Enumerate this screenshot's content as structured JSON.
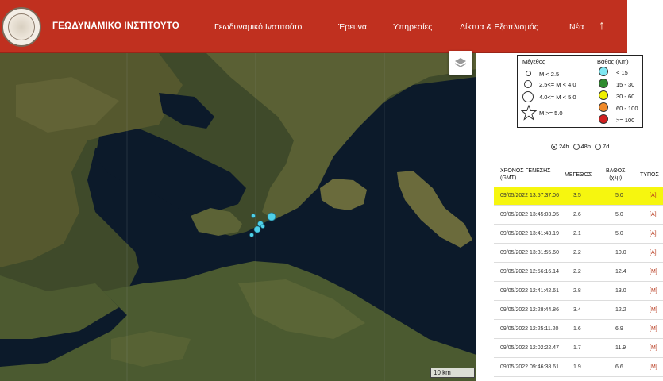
{
  "header": {
    "brand": "ΓΕΩΔΥΝΑΜΙΚΟ ΙΝΣΤΙΤΟΥΤΟ",
    "nav": [
      "Γεωδυναμικό Ινστιτούτο",
      "Έρευνα",
      "Υπηρεσίες",
      "Δίκτυα & Εξοπλισμός",
      "Νέα"
    ],
    "up_arrow": "↑"
  },
  "map": {
    "scale_label": "10 km",
    "layers_icon": "layers-icon",
    "event_color": "#4fd0e8"
  },
  "legend": {
    "magnitude_title": "Μέγεθος",
    "magnitude_items": [
      "M < 2.5",
      "2.5<= M < 4.0",
      "4.0<= M < 5.0",
      "M >= 5.0"
    ],
    "depth_title": "Βάθος (Km)",
    "depth_items": [
      {
        "label": "< 15",
        "color": "#7fe7f2"
      },
      {
        "label": "15 - 30",
        "color": "#2e8b2e"
      },
      {
        "label": "30 - 60",
        "color": "#f0f000"
      },
      {
        "label": "60 - 100",
        "color": "#f08a2a"
      },
      {
        "label": ">= 100",
        "color": "#d12020"
      }
    ]
  },
  "periods": {
    "options": [
      "24h",
      "48h",
      "7d"
    ],
    "selected": "24h"
  },
  "table": {
    "headers": {
      "time": "ΧΡΟΝΟΣ ΓΕΝΕΣΗΣ\n(GMT)",
      "magnitude": "ΜΕΓΕΘΟΣ",
      "depth": "ΒΑΘΟΣ\n(χλμ)",
      "type": "ΤΥΠΟΣ"
    },
    "rows": [
      {
        "time": "09/05/2022 13:57:37.06",
        "mag": "3.5",
        "depth": "5.0",
        "type": "[A]"
      },
      {
        "time": "09/05/2022 13:45:03.95",
        "mag": "2.6",
        "depth": "5.0",
        "type": "[A]"
      },
      {
        "time": "09/05/2022 13:41:43.19",
        "mag": "2.1",
        "depth": "5.0",
        "type": "[A]"
      },
      {
        "time": "09/05/2022 13:31:55.60",
        "mag": "2.2",
        "depth": "10.0",
        "type": "[A]"
      },
      {
        "time": "09/05/2022 12:56:16.14",
        "mag": "2.2",
        "depth": "12.4",
        "type": "[M]"
      },
      {
        "time": "09/05/2022 12:41:42.61",
        "mag": "2.8",
        "depth": "13.0",
        "type": "[M]"
      },
      {
        "time": "09/05/2022 12:28:44.86",
        "mag": "3.4",
        "depth": "12.2",
        "type": "[M]"
      },
      {
        "time": "09/05/2022 12:25:11.20",
        "mag": "1.6",
        "depth": "6.9",
        "type": "[M]"
      },
      {
        "time": "09/05/2022 12:02:22.47",
        "mag": "1.7",
        "depth": "11.9",
        "type": "[M]"
      },
      {
        "time": "09/05/2022 09:46:38.61",
        "mag": "1.9",
        "depth": "6.6",
        "type": "[M]"
      }
    ]
  }
}
